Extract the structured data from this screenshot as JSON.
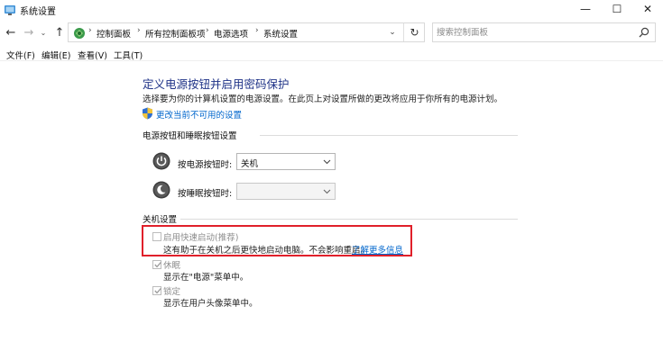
{
  "window": {
    "title": "系统设置",
    "min_glyph": "—",
    "max_glyph": "☐",
    "close_glyph": "✕"
  },
  "nav": {
    "back_glyph": "←",
    "forward_glyph": "→",
    "history_glyph": "⌄",
    "up_glyph": "↑",
    "breadcrumbs": [
      "控制面板",
      "所有控制面板项",
      "电源选项",
      "系统设置"
    ],
    "separator": "›",
    "dropdown_glyph": "⌄",
    "refresh_glyph": "↻",
    "search_placeholder": "搜索控制面板"
  },
  "menu": {
    "items": [
      "文件(F)",
      "编辑(E)",
      "查看(V)",
      "工具(T)"
    ]
  },
  "content": {
    "heading": "定义电源按钮并启用密码保护",
    "description": "选择要为你的计算机设置的电源设置。在此页上对设置所做的更改将应用于你所有的电源计划。",
    "change_link": "更改当前不可用的设置",
    "power_section": {
      "title": "电源按钮和睡眠按钮设置",
      "power_button_label": "按电源按钮时:",
      "power_button_value": "关机",
      "sleep_button_label": "按睡眠按钮时:",
      "sleep_button_value": ""
    },
    "shutdown_section": {
      "title": "关机设置",
      "fast_startup_label": "启用快速启动(推荐)",
      "fast_startup_checked": false,
      "fast_startup_desc": "这有助于在关机之后更快地启动电脑。不会影响重启。",
      "learn_more": "了解更多信息",
      "hibernate_label": "休眠",
      "hibernate_checked": true,
      "hibernate_desc": "显示在\"电源\"菜单中。",
      "lock_label": "锁定",
      "lock_checked": true,
      "lock_desc": "显示在用户头像菜单中。"
    }
  },
  "colors": {
    "heading": "#1e3287",
    "link": "#0066cc",
    "highlight_border": "#e0202a"
  }
}
